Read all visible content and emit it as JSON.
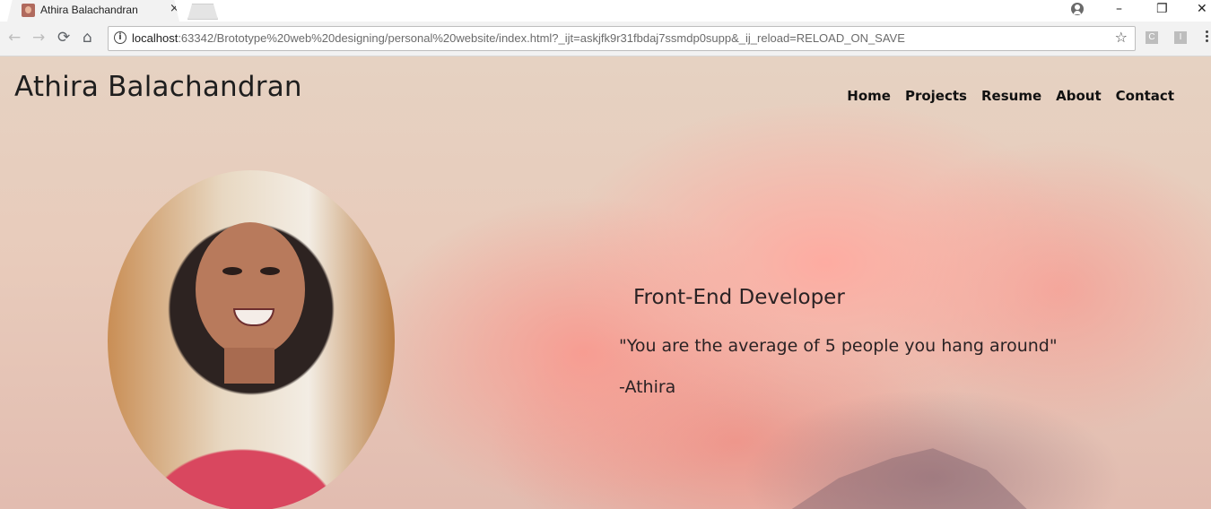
{
  "browser": {
    "tab": {
      "title": "Athira Balachandran",
      "close_glyph": "×"
    },
    "window_controls": {
      "minimize": "–",
      "restore": "❐",
      "close": "✕"
    },
    "nav": {
      "back": "←",
      "forward": "→",
      "reload": "⟳",
      "home": "⌂"
    },
    "address": {
      "host": "localhost",
      "rest": ":63342/Brototype%20web%20designing/personal%20website/index.html?_ijt=askjfk9r31fbdaj7ssmdp0supp&_ij_reload=RELOAD_ON_SAVE",
      "info_glyph": "i",
      "star_glyph": "☆"
    },
    "extensions": [
      "C",
      "I"
    ]
  },
  "site": {
    "title": "Athira Balachandran",
    "nav": [
      "Home",
      "Projects",
      "Resume",
      "About",
      "Contact"
    ],
    "hero": {
      "headline": "Front-End Developer",
      "quote": "\"You are the average of 5 people you hang around\"",
      "author": "-Athira"
    }
  },
  "colors": {
    "text": "#1e1e1e",
    "background_top": "#e6d2c2",
    "cloud": "#f5a59a"
  }
}
